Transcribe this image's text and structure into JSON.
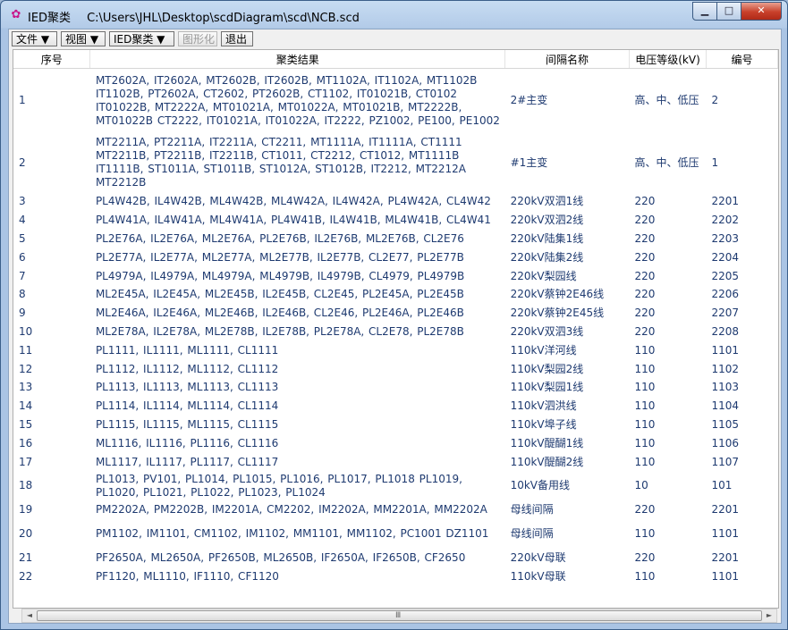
{
  "window": {
    "app_name": "IED聚类",
    "file_path": "C:\\Users\\JHL\\Desktop\\scdDiagram\\scd\\NCB.scd",
    "minimize": "▁",
    "maximize": "□",
    "close": "✕",
    "app_icon": "✿"
  },
  "menu": [
    {
      "label": "文件 ▼",
      "enabled": true
    },
    {
      "label": "视图 ▼",
      "enabled": true
    },
    {
      "label": "IED聚类 ▼",
      "enabled": true
    },
    {
      "label": "图形化",
      "enabled": false
    },
    {
      "label": "退出",
      "enabled": true
    }
  ],
  "columns": [
    "序号",
    "聚类结果",
    "间隔名称",
    "电压等级(kV)",
    "编号"
  ],
  "rows": [
    {
      "no": "1",
      "result": "MT2602A, IT2602A, MT2602B, IT2602B, MT1102A, IT1102A, MT1102B IT1102B, PT2602A, CT2602, PT2602B, CT1102, IT01021B, CT0102 IT01022B, MT2222A, MT01021A, MT01022A, MT01021B, MT2222B, MT01022B CT2222, IT01021A, IT01022A, IT2222, PZ1002, PE100, PE1002",
      "bay": "2#主变",
      "voltage": "高、中、低压",
      "code": "2"
    },
    {
      "no": "2",
      "result": "MT2211A, PT2211A, IT2211A, CT2211, MT1111A, IT1111A, CT1111 MT2211B, PT2211B, IT2211B, CT1011, CT2212, CT1012, MT1111B IT1111B, ST1011A, ST1011B, ST1012A, ST1012B, IT2212, MT2212A MT2212B",
      "bay": "#1主变",
      "voltage": "高、中、低压",
      "code": "1"
    },
    {
      "no": "3",
      "result": "PL4W42B, IL4W42B, ML4W42B, ML4W42A, IL4W42A, PL4W42A, CL4W42",
      "bay": "220kV双泗1线",
      "voltage": "220",
      "code": "2201"
    },
    {
      "no": "4",
      "result": "PL4W41A, IL4W41A, ML4W41A, PL4W41B, IL4W41B, ML4W41B, CL4W41",
      "bay": "220kV双泗2线",
      "voltage": "220",
      "code": "2202"
    },
    {
      "no": "5",
      "result": "PL2E76A, IL2E76A, ML2E76A, PL2E76B, IL2E76B, ML2E76B, CL2E76",
      "bay": "220kV陆集1线",
      "voltage": "220",
      "code": "2203"
    },
    {
      "no": "6",
      "result": "PL2E77A, IL2E77A, ML2E77A, ML2E77B, IL2E77B, CL2E77, PL2E77B",
      "bay": "220kV陆集2线",
      "voltage": "220",
      "code": "2204"
    },
    {
      "no": "7",
      "result": "PL4979A, IL4979A, ML4979A, ML4979B, IL4979B, CL4979, PL4979B",
      "bay": "220kV梨园线",
      "voltage": "220",
      "code": "2205"
    },
    {
      "no": "8",
      "result": "ML2E45A, IL2E45A, ML2E45B, IL2E45B, CL2E45, PL2E45A, PL2E45B",
      "bay": "220kV蔡钟2E46线",
      "voltage": "220",
      "code": "2206"
    },
    {
      "no": "9",
      "result": "ML2E46A, IL2E46A, ML2E46B, IL2E46B, CL2E46, PL2E46A, PL2E46B",
      "bay": "220kV蔡钟2E45线",
      "voltage": "220",
      "code": "2207"
    },
    {
      "no": "10",
      "result": "ML2E78A, IL2E78A, ML2E78B, IL2E78B, PL2E78A, CL2E78, PL2E78B",
      "bay": "220kV双泗3线",
      "voltage": "220",
      "code": "2208"
    },
    {
      "no": "11",
      "result": "PL1111, IL1111, ML1111, CL1111",
      "bay": "110kV洋河线",
      "voltage": "110",
      "code": "1101"
    },
    {
      "no": "12",
      "result": "PL1112, IL1112, ML1112, CL1112",
      "bay": "110kV梨园2线",
      "voltage": "110",
      "code": "1102"
    },
    {
      "no": "13",
      "result": "PL1113, IL1113, ML1113, CL1113",
      "bay": "110kV梨园1线",
      "voltage": "110",
      "code": "1103"
    },
    {
      "no": "14",
      "result": "PL1114, IL1114, ML1114, CL1114",
      "bay": "110kV泗洪线",
      "voltage": "110",
      "code": "1104"
    },
    {
      "no": "15",
      "result": "PL1115, IL1115, ML1115, CL1115",
      "bay": "110kV埠子线",
      "voltage": "110",
      "code": "1105"
    },
    {
      "no": "16",
      "result": "ML1116, IL1116, PL1116, CL1116",
      "bay": "110kV醍醐1线",
      "voltage": "110",
      "code": "1106"
    },
    {
      "no": "17",
      "result": "ML1117, IL1117, PL1117, CL1117",
      "bay": "110kV醍醐2线",
      "voltage": "110",
      "code": "1107"
    },
    {
      "no": "18",
      "result": "PL1013, PV101, PL1014, PL1015, PL1016, PL1017, PL1018 PL1019, PL1020, PL1021, PL1022, PL1023, PL1024",
      "bay": "10kV备用线",
      "voltage": "10",
      "code": "101"
    },
    {
      "no": "19",
      "result": "PM2202A, PM2202B, IM2201A, CM2202, IM2202A, MM2201A, MM2202A",
      "bay": "母线间隔",
      "voltage": "220",
      "code": "2201"
    },
    {
      "no": "20",
      "result": "PM1102, IM1101, CM1102, IM1102, MM1101, MM1102, PC1001 DZ1101",
      "bay": "母线间隔",
      "voltage": "110",
      "code": "1101"
    },
    {
      "no": "21",
      "result": "PF2650A, ML2650A, PF2650B, ML2650B, IF2650A, IF2650B, CF2650",
      "bay": "220kV母联",
      "voltage": "220",
      "code": "2201"
    },
    {
      "no": "22",
      "result": "PF1120, ML1110, IF1110, CF1120",
      "bay": "110kV母联",
      "voltage": "110",
      "code": "1101"
    }
  ],
  "scrollbar": {
    "left": "◄",
    "right": "►",
    "grip": "Ⅲ"
  }
}
